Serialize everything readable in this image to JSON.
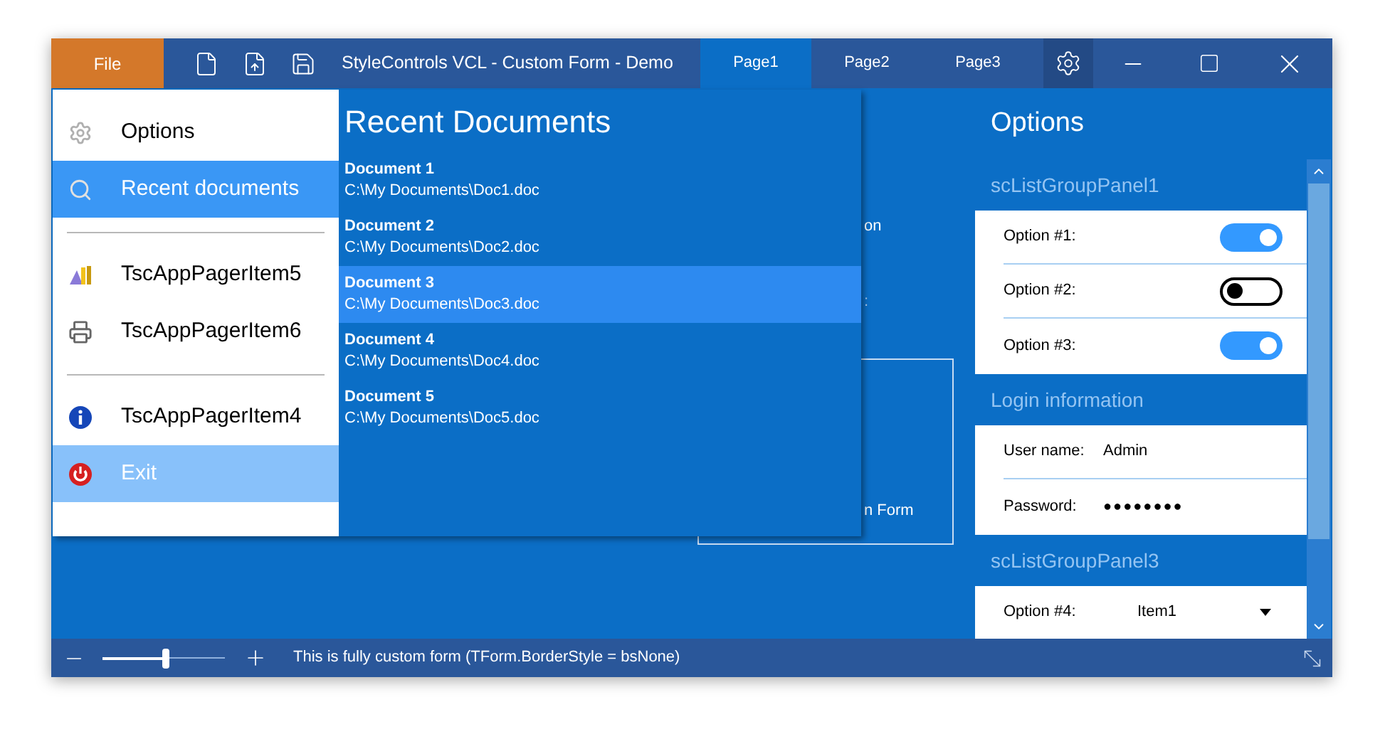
{
  "window": {
    "title": "StyleControls VCL - Custom Form - Demo",
    "file_button": "File"
  },
  "tabs": [
    {
      "label": "Page1",
      "selected": true
    },
    {
      "label": "Page2",
      "selected": false
    },
    {
      "label": "Page3",
      "selected": false
    }
  ],
  "background_texts": [
    "on",
    ":",
    "n Form"
  ],
  "backstage": {
    "items": [
      {
        "kind": "item",
        "label": "Options",
        "selected": false,
        "highlighted": false
      },
      {
        "kind": "item",
        "label": "Recent documents",
        "selected": true,
        "highlighted": false
      },
      {
        "kind": "separator"
      },
      {
        "kind": "item",
        "label": "TscAppPagerItem5",
        "selected": false,
        "highlighted": false
      },
      {
        "kind": "item",
        "label": "TscAppPagerItem6",
        "selected": false,
        "highlighted": false
      },
      {
        "kind": "separator"
      },
      {
        "kind": "item",
        "label": "TscAppPagerItem4",
        "selected": false,
        "highlighted": false
      },
      {
        "kind": "item",
        "label": "Exit",
        "selected": false,
        "highlighted": true
      }
    ],
    "recent": {
      "title": "Recent Documents",
      "documents": [
        {
          "name": "Document 1",
          "path": "C:\\My Documents\\Doc1.doc",
          "selected": false
        },
        {
          "name": "Document 2",
          "path": "C:\\My Documents\\Doc2.doc",
          "selected": false
        },
        {
          "name": "Document 3",
          "path": "C:\\My Documents\\Doc3.doc",
          "selected": true
        },
        {
          "name": "Document 4",
          "path": "C:\\My Documents\\Doc4.doc",
          "selected": false
        },
        {
          "name": "Document 5",
          "path": "C:\\My Documents\\Doc5.doc",
          "selected": false
        }
      ]
    }
  },
  "options_panel": {
    "title": "Options",
    "groups": [
      {
        "title": "scListGroupPanel1",
        "rows": [
          {
            "kind": "toggle",
            "label": "Option #1:",
            "on": true
          },
          {
            "kind": "toggle",
            "label": "Option #2:",
            "on": false
          },
          {
            "kind": "toggle",
            "label": "Option #3:",
            "on": true
          }
        ]
      },
      {
        "title": "Login information",
        "rows": [
          {
            "kind": "text",
            "label": "User name:",
            "value": "Admin"
          },
          {
            "kind": "text",
            "label": "Password:",
            "value": "●●●●●●●●"
          }
        ]
      },
      {
        "title": "scListGroupPanel3",
        "rows": [
          {
            "kind": "combo",
            "label": "Option #4:",
            "value": "Item1"
          }
        ]
      }
    ]
  },
  "status_bar": {
    "zoom": {
      "level": 0.51
    },
    "text": "This is fully custom form (TForm.BorderStyle = bsNone)"
  }
}
